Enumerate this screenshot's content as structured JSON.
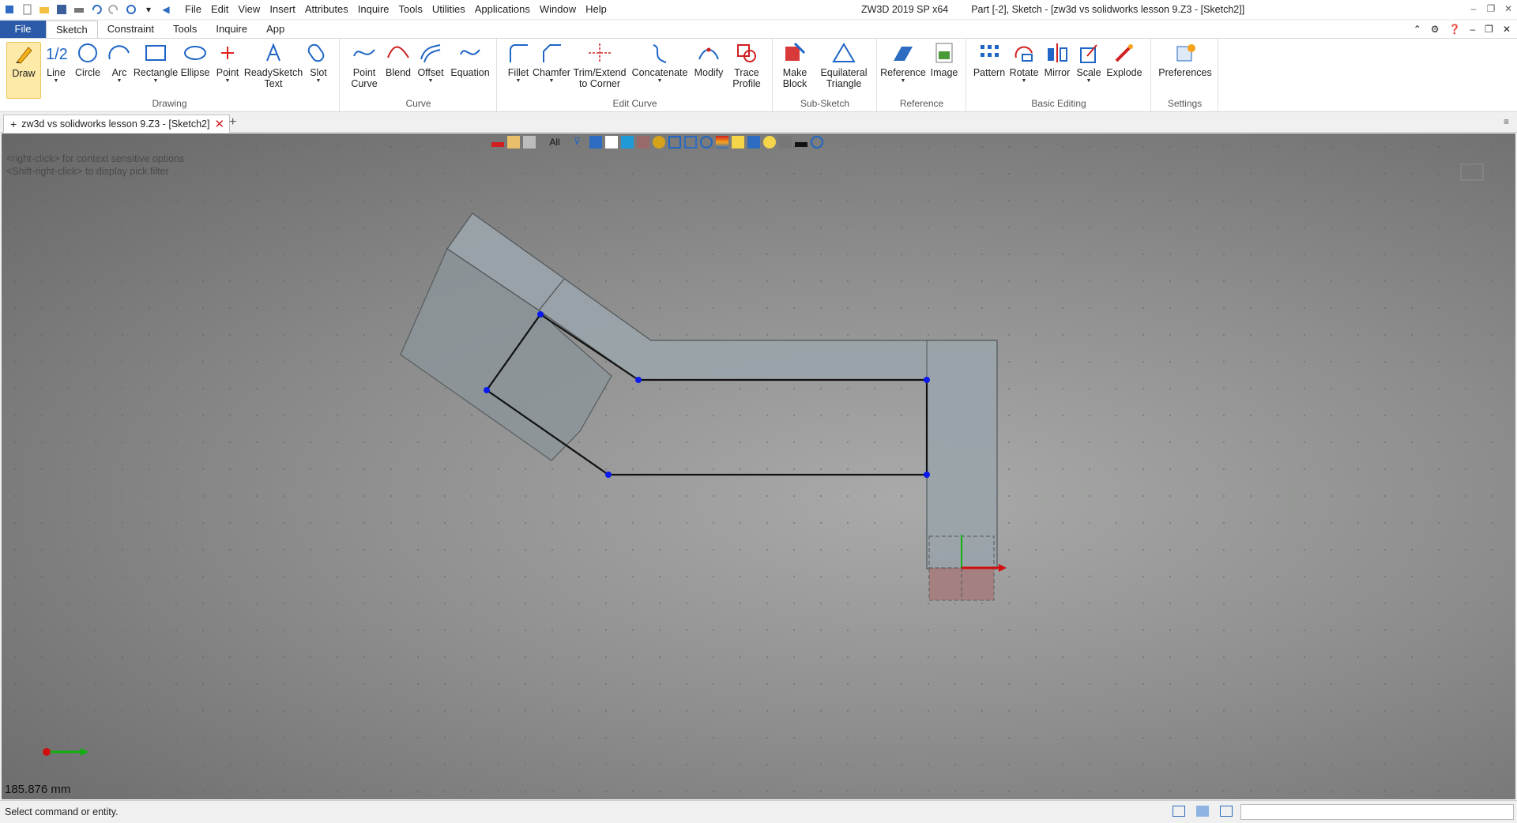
{
  "window": {
    "app_title": "ZW3D 2019 SP x64",
    "doc_title": "Part [-2],  Sketch - [zw3d vs solidworks lesson 9.Z3 - [Sketch2]]"
  },
  "menu": [
    "File",
    "Edit",
    "View",
    "Insert",
    "Attributes",
    "Inquire",
    "Tools",
    "Utilities",
    "Applications",
    "Window",
    "Help"
  ],
  "ribbon_tabs": {
    "file": "File",
    "items": [
      "Sketch",
      "Constraint",
      "Tools",
      "Inquire",
      "App"
    ],
    "active": "Sketch"
  },
  "groups": {
    "drawing": "Drawing",
    "curve": "Curve",
    "edit_curve": "Edit Curve",
    "sub_sketch": "Sub-Sketch",
    "reference": "Reference",
    "basic_editing": "Basic Editing",
    "settings": "Settings"
  },
  "tools": {
    "draw": "Draw",
    "line": "Line",
    "circle": "Circle",
    "arc": "Arc",
    "rectangle": "Rectangle",
    "ellipse": "Ellipse",
    "point": "Point",
    "readysketch_1": "ReadySketch",
    "readysketch_2": "Text",
    "slot": "Slot",
    "point_curve_1": "Point",
    "point_curve_2": "Curve",
    "blend": "Blend",
    "offset": "Offset",
    "equation": "Equation",
    "fillet": "Fillet",
    "chamfer": "Chamfer",
    "trim_1": "Trim/Extend",
    "trim_2": "to Corner",
    "concatenate": "Concatenate",
    "modify": "Modify",
    "trace_1": "Trace",
    "trace_2": "Profile",
    "make_block_1": "Make",
    "make_block_2": "Block",
    "eq_tri_1": "Equilateral",
    "eq_tri_2": "Triangle",
    "reference": "Reference",
    "image": "Image",
    "pattern": "Pattern",
    "rotate": "Rotate",
    "mirror": "Mirror",
    "scale": "Scale",
    "explode": "Explode",
    "preferences": "Preferences",
    "line_icon_text": "1/2"
  },
  "document_tab": {
    "label": "zw3d vs solidworks lesson 9.Z3 - [Sketch2]"
  },
  "viewport": {
    "hint_1": "<right-click> for context sensitive options",
    "hint_2": "<Shift-right-click> to display pick filter",
    "filter_label": "All",
    "measure": "185.876 mm"
  },
  "status": {
    "message": "Select command or entity."
  },
  "colors": {
    "file_tab": "#2a5aa8",
    "sketch_fill": "#9aa4aa",
    "point": "#0a1aee",
    "axis_x": "#d01010",
    "axis_y": "#10b010"
  }
}
